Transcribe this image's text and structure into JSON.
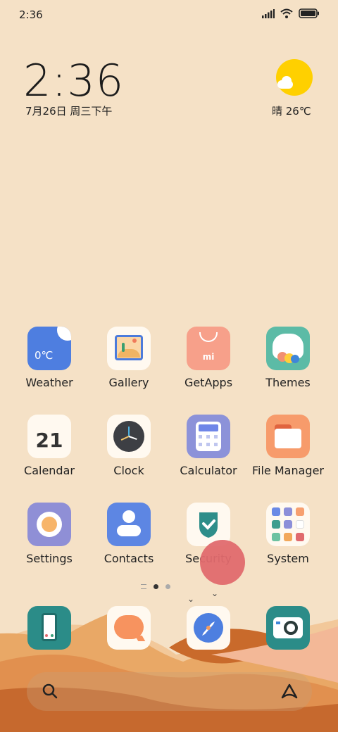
{
  "status_bar": {
    "time": "2:36"
  },
  "clock_widget": {
    "time": "2:36",
    "date": "7月26日 周三下午"
  },
  "weather_widget": {
    "text": "晴 26℃"
  },
  "apps": [
    {
      "label": "Weather",
      "icon": "weather-icon",
      "badge": "0℃"
    },
    {
      "label": "Gallery",
      "icon": "gallery-icon"
    },
    {
      "label": "GetApps",
      "icon": "getapps-icon",
      "badge": "mi"
    },
    {
      "label": "Themes",
      "icon": "themes-icon"
    },
    {
      "label": "Calendar",
      "icon": "calendar-icon",
      "badge": "21"
    },
    {
      "label": "Clock",
      "icon": "clock-icon"
    },
    {
      "label": "Calculator",
      "icon": "calculator-icon"
    },
    {
      "label": "File Manager",
      "icon": "file-manager-icon"
    },
    {
      "label": "Settings",
      "icon": "settings-icon"
    },
    {
      "label": "Contacts",
      "icon": "contacts-icon"
    },
    {
      "label": "Security",
      "icon": "security-icon"
    },
    {
      "label": "System",
      "icon": "system-folder-icon"
    }
  ],
  "dock": [
    {
      "icon": "phone-icon"
    },
    {
      "icon": "messages-icon"
    },
    {
      "icon": "browser-icon"
    },
    {
      "icon": "camera-icon"
    }
  ],
  "page_indicator": {
    "pages": 2,
    "current": 1
  },
  "colors": {
    "wallpaper": "#f5e1c6",
    "accent_red": "#e06a6e"
  }
}
